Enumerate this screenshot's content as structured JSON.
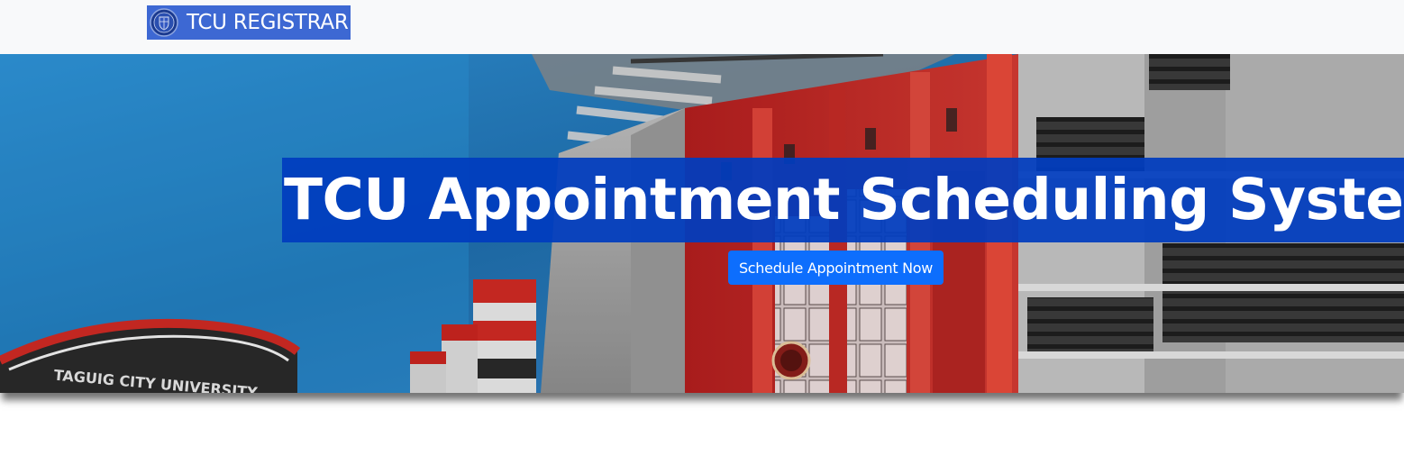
{
  "navbar": {
    "brand_label": "TCU REGISTRAR",
    "brand_icon": "university-seal-icon"
  },
  "hero": {
    "title": "TCU Appointment Scheduling System",
    "cta_label": "Schedule Appointment Now",
    "sign_text": "TAGUIG CITY UNIVERSITY",
    "image": "campus-building-photo"
  },
  "colors": {
    "navbar_bg": "#f8f9fa",
    "brand_bg": "#3d68d3",
    "title_bg": "#003cbe",
    "button_bg": "#0d6efd",
    "text_light": "#ffffff"
  }
}
